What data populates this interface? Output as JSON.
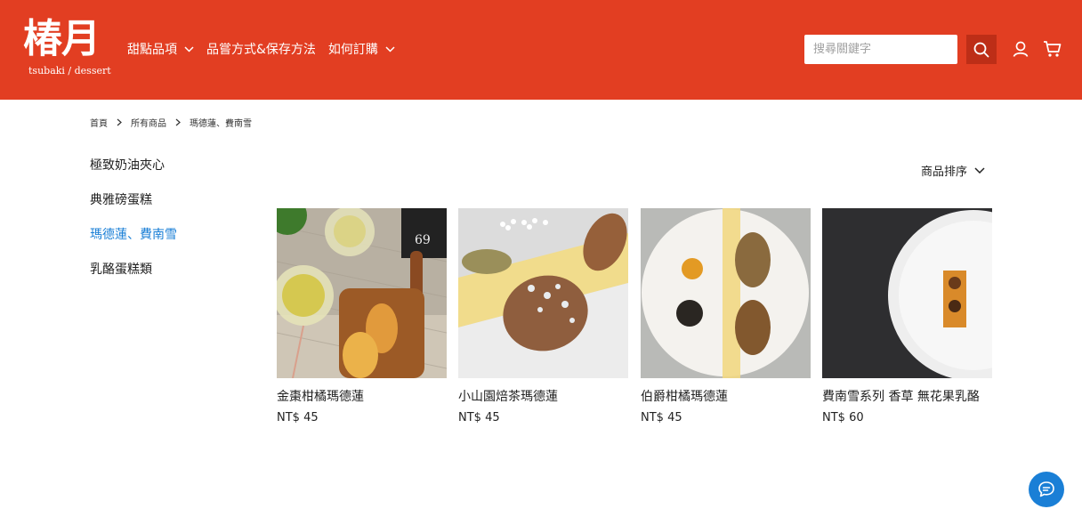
{
  "brand": {
    "logo_text": "椿月",
    "logo_sub": "tsubaki / dessert"
  },
  "nav": {
    "items": [
      {
        "label": "甜點品項",
        "has_dropdown": true
      },
      {
        "label": "品嘗方式&保存方法",
        "has_dropdown": false
      },
      {
        "label": "如何訂購",
        "has_dropdown": true
      }
    ]
  },
  "header": {
    "search_placeholder": "搜尋關鍵字",
    "search_value": "",
    "icons": [
      "search-icon",
      "user-icon",
      "cart-icon"
    ]
  },
  "breadcrumb": [
    "首頁",
    "所有商品",
    "瑪德蓮、費南雪"
  ],
  "sidebar": {
    "items": [
      {
        "label": "極致奶油夾心",
        "active": false
      },
      {
        "label": "典雅磅蛋糕",
        "active": false
      },
      {
        "label": "瑪德蓮、費南雪",
        "active": true
      },
      {
        "label": "乳酪蛋糕類",
        "active": false
      }
    ]
  },
  "sort": {
    "label": "商品排序"
  },
  "products": [
    {
      "name": "金棗柑橘瑪德蓮",
      "price": "NT$ 45"
    },
    {
      "name": "小山園焙茶瑪德蓮",
      "price": "NT$ 45"
    },
    {
      "name": "伯爵柑橘瑪德蓮",
      "price": "NT$ 45"
    },
    {
      "name": "費南雪系列 香草 無花果乳酪",
      "price": "NT$ 60"
    }
  ],
  "colors": {
    "header_bg": "#e23e22",
    "search_btn": "#bd2e17",
    "accent_blue": "#1a7fd6"
  },
  "chat": {
    "icon": "chat-icon"
  }
}
